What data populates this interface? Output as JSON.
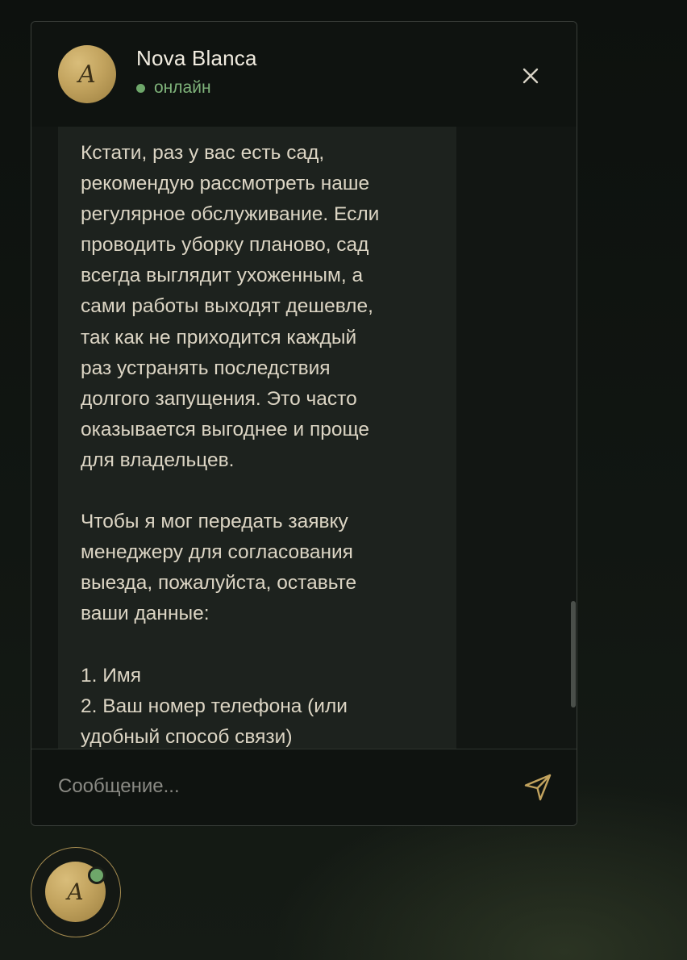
{
  "colors": {
    "accent_gold": "#c2a35e",
    "online_green": "#6ea76a",
    "panel_background": "#121613",
    "bubble_background": "#1d221e",
    "text_primary": "#dcd5c4"
  },
  "header": {
    "avatar_letter": "A",
    "agent_name": "Nova Blanca",
    "status_text": "онлайн",
    "close_icon": "close-icon"
  },
  "messages": [
    {
      "sender": "agent",
      "text": "Кстати, раз у вас есть сад,\nрекомендую рассмотреть наше\nрегулярное обслуживание. Если\nпроводить уборку планово, сад\nвсегда выглядит ухоженным, а\nсами работы выходят дешевле,\nтак как не приходится каждый\nраз устранять последствия\nдолгого запущения. Это часто\nоказывается выгоднее и проще\nдля владельцев.\n\nЧтобы я мог передать заявку\nменеджеру для согласования\nвыезда, пожалуйста, оставьте\nваши данные:\n\n1. Имя\n2. Ваш номер телефона (или\nудобный способ связи)"
    }
  ],
  "composer": {
    "placeholder": "Сообщение...",
    "value": "",
    "send_icon": "send-icon"
  },
  "launcher": {
    "avatar_letter": "A",
    "online": true
  }
}
